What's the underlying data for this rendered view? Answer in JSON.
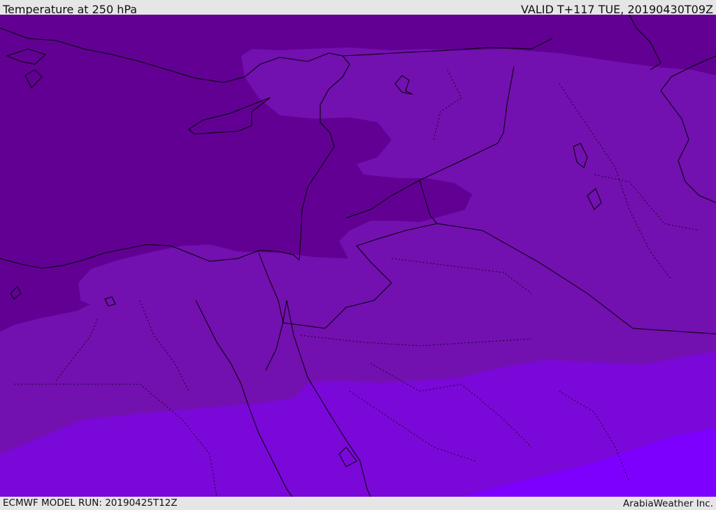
{
  "header": {
    "title": "Temperature at 250 hPa",
    "valid": "VALID T+117 TUE, 20190430T09Z"
  },
  "footer": {
    "model_run": "ECMWF MODEL RUN: 20190425T12Z",
    "credit": "ArabiaWeather Inc."
  },
  "palette": {
    "band_1_darkest": "#620094",
    "band_2": "#7310B0",
    "band_3": "#7A08D8",
    "band_4_lightest": "#7D00FF",
    "coastline": "#000000",
    "border": "#000000"
  }
}
